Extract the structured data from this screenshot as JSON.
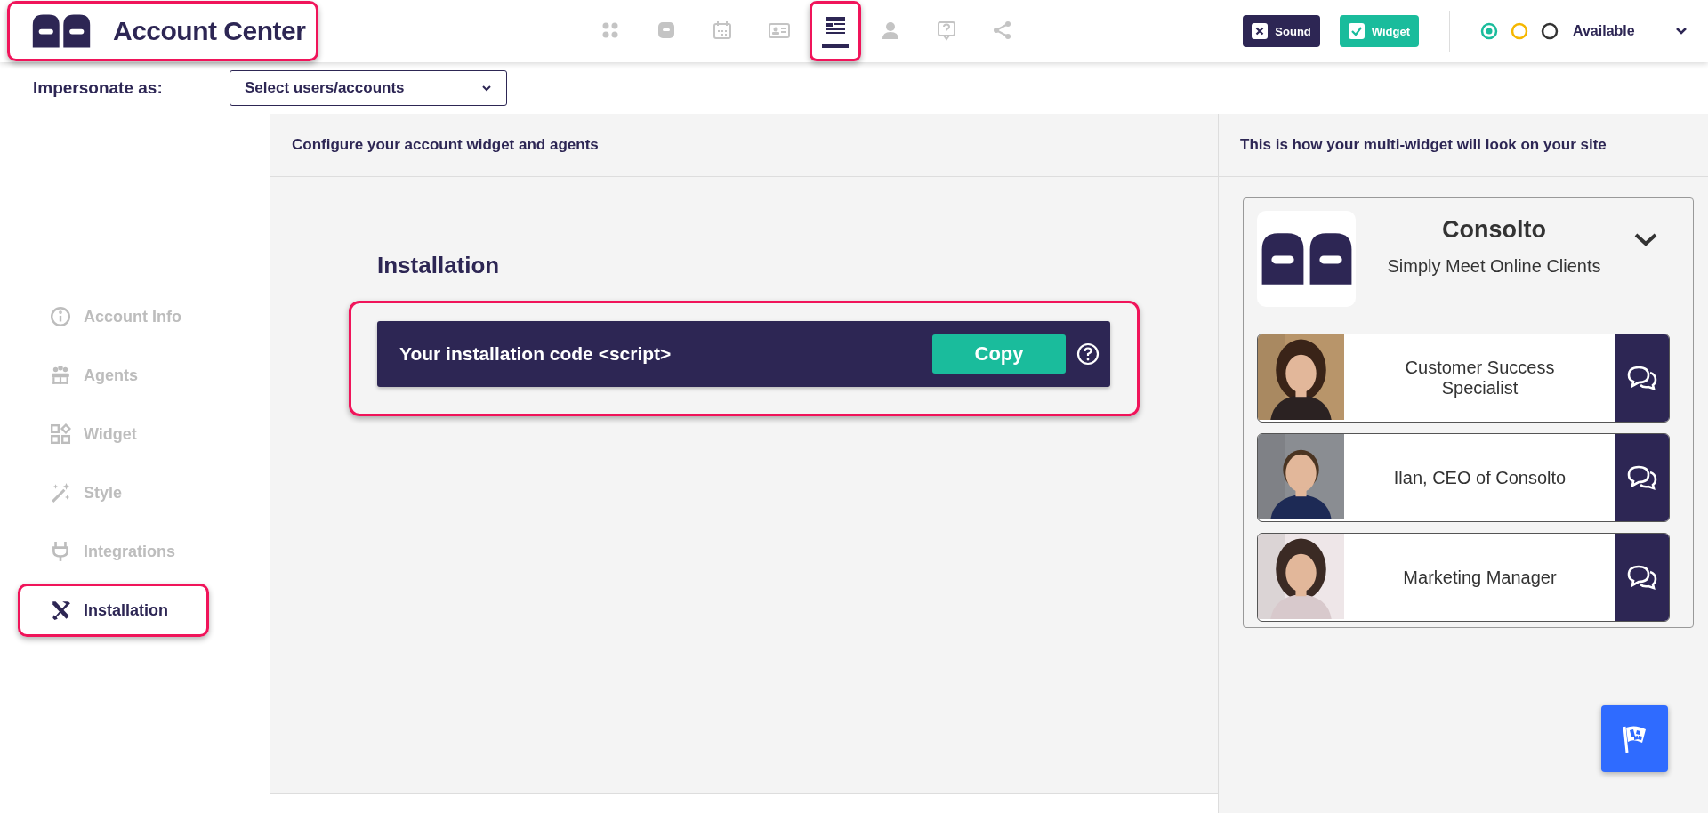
{
  "header": {
    "logo_highlighted": true,
    "title": "Account Center",
    "nav": [
      {
        "selected": false,
        "highlighted": false
      },
      {
        "selected": false,
        "highlighted": false
      },
      {
        "selected": false,
        "highlighted": false
      },
      {
        "selected": false,
        "highlighted": false
      },
      {
        "selected": true,
        "highlighted": true
      },
      {
        "selected": false,
        "highlighted": false
      },
      {
        "selected": false,
        "highlighted": false
      },
      {
        "selected": false,
        "highlighted": false
      }
    ],
    "sound_toggle": {
      "label": "Sound",
      "checked": false
    },
    "widget_toggle": {
      "label": "Widget",
      "checked": true
    },
    "status_options": [
      {
        "selected": true,
        "color": "#1abc9c"
      },
      {
        "selected": false,
        "color": "#f5b700"
      },
      {
        "selected": false,
        "color": "#333333"
      }
    ],
    "status_label": "Available"
  },
  "impersonate": {
    "label": "Impersonate as:",
    "placeholder": "Select users/accounts"
  },
  "sidebar": {
    "items": [
      {
        "label": "Account Info",
        "selected": false,
        "highlighted": false
      },
      {
        "label": "Agents",
        "selected": false,
        "highlighted": false
      },
      {
        "label": "Widget",
        "selected": false,
        "highlighted": false
      },
      {
        "label": "Style",
        "selected": false,
        "highlighted": false
      },
      {
        "label": "Integrations",
        "selected": false,
        "highlighted": false
      },
      {
        "label": "Installation",
        "selected": true,
        "highlighted": true
      }
    ]
  },
  "main": {
    "header": "Configure your account widget and agents",
    "section_title": "Installation",
    "code_bar": {
      "label": "Your installation code <script>",
      "button": "Copy",
      "highlighted": true
    }
  },
  "preview": {
    "header": "This is how your multi-widget will look on your site",
    "brand": "Consolto",
    "tagline": "Simply Meet Online Clients",
    "expanded": false,
    "agents": [
      {
        "title": "Customer Success Specialist"
      },
      {
        "title": "Ilan, CEO of Consolto"
      },
      {
        "title": "Marketing Manager"
      }
    ]
  }
}
